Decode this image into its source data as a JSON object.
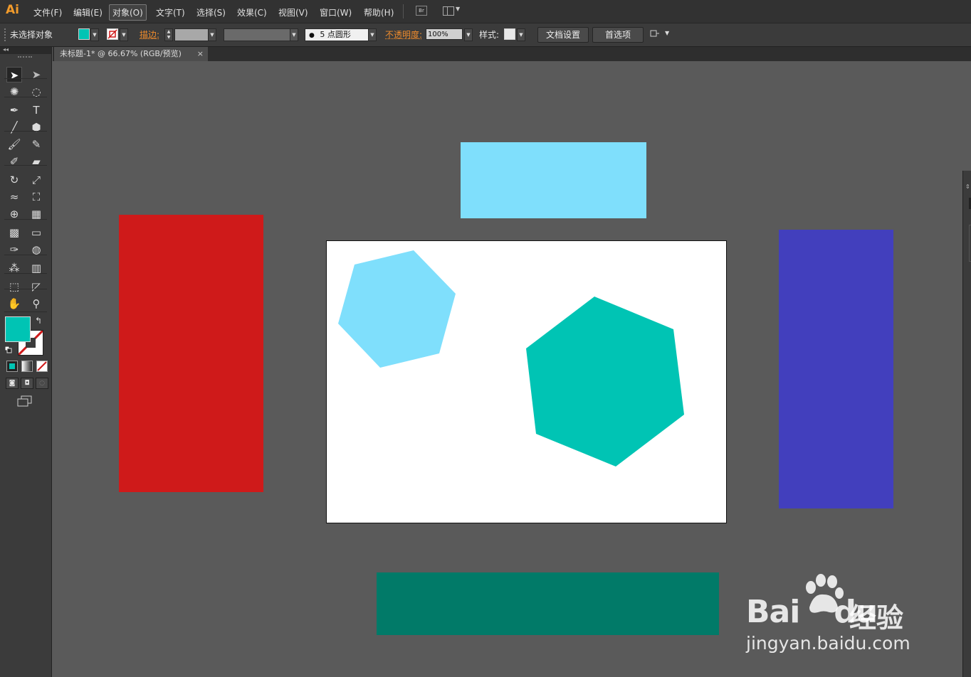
{
  "app": {
    "logo": "Ai"
  },
  "menu": {
    "items": [
      "文件(F)",
      "编辑(E)",
      "对象(O)",
      "文字(T)",
      "选择(S)",
      "效果(C)",
      "视图(V)",
      "窗口(W)",
      "帮助(H)"
    ],
    "active": "对象(O)",
    "br_label": "Br"
  },
  "control_bar": {
    "selection_status": "未选择对象",
    "fill_color": "#00c4b4",
    "stroke_label": "描边:",
    "brush_label": "5 点圆形",
    "opacity_label": "不透明度:",
    "opacity_value": "100%",
    "style_label": "样式:",
    "doc_setup_button": "文档设置",
    "preferences_button": "首选项"
  },
  "document_tab": {
    "title": "未标题-1* @ 66.67% (RGB/预览)",
    "close": "×"
  },
  "tools_panel": {
    "fill_color": "#00c4b4",
    "tools": [
      [
        "selection-tool",
        "direct-selection-tool"
      ],
      [
        "magic-wand-tool",
        "lasso-tool"
      ],
      [
        "pen-tool",
        "type-tool"
      ],
      [
        "line-segment-tool",
        "polygon-tool"
      ],
      [
        "paintbrush-tool",
        "pencil-tool"
      ],
      [
        "blob-brush-tool",
        "eraser-tool"
      ],
      [
        "rotate-tool",
        "scale-tool"
      ],
      [
        "warp-tool",
        "free-transform-tool"
      ],
      [
        "shape-builder-tool",
        "perspective-grid-tool"
      ],
      [
        "mesh-tool",
        "gradient-tool"
      ],
      [
        "eyedropper-tool",
        "blend-tool"
      ],
      [
        "symbol-sprayer-tool",
        "column-graph-tool"
      ],
      [
        "artboard-tool",
        "slice-tool"
      ],
      [
        "hand-tool",
        "zoom-tool"
      ]
    ],
    "type_tool_glyph": "T"
  },
  "canvas": {
    "colors": {
      "light_blue": "#7fdffc",
      "red": "#cf1a1a",
      "indigo": "#423fbd",
      "teal_dark": "#017a68",
      "teal": "#00c4b4",
      "artboard": "#ffffff"
    }
  },
  "watermark": {
    "brand_left": "Bai",
    "brand_right": "du",
    "brand_cn": "经验",
    "url": "jingyan.baidu.com"
  }
}
